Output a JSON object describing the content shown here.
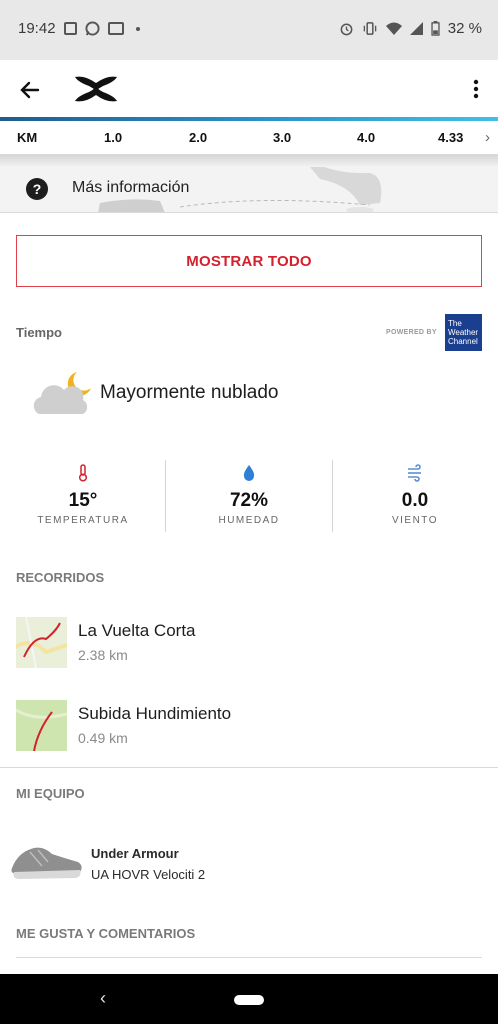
{
  "status_bar": {
    "time": "19:42",
    "left_icons": [
      "image-icon",
      "whatsapp-icon",
      "contact-card-icon",
      "dot-icon"
    ],
    "right_icons": [
      "alarm-icon",
      "vibrate-icon",
      "wifi-icon",
      "signal-icon",
      "battery-icon"
    ],
    "battery": "32 %"
  },
  "toolbar": {
    "back_icon": "arrow-left-icon",
    "logo": "under-armour-logo",
    "menu_icon": "more-vert-icon"
  },
  "splits": {
    "unit": "KM",
    "values": [
      "1.0",
      "2.0",
      "3.0",
      "4.0",
      "4.33"
    ]
  },
  "more_info": {
    "label": "Más información"
  },
  "show_all": {
    "label": "MOSTRAR TODO"
  },
  "weather": {
    "title": "Tiempo",
    "powered_by": "POWERED BY",
    "provider": "The Weather Channel",
    "provider_lines": [
      "The",
      "Weather",
      "Channel"
    ],
    "condition": "Mayormente nublado",
    "stats": [
      {
        "icon": "thermometer-icon",
        "value": "15°",
        "label": "TEMPERATURA"
      },
      {
        "icon": "water-drop-icon",
        "value": "72%",
        "label": "HUMEDAD"
      },
      {
        "icon": "wind-icon",
        "value": "0.0",
        "label": "VIENTO"
      }
    ]
  },
  "routes": {
    "title": "RECORRIDOS",
    "items": [
      {
        "name": "La Vuelta Corta",
        "distance": "2.38 km"
      },
      {
        "name": "Subida Hundimiento",
        "distance": "0.49 km"
      }
    ]
  },
  "equipment": {
    "title": "MI EQUIPO",
    "brand": "Under Armour",
    "model": "UA HOVR Velociti 2"
  },
  "likes": {
    "title": "ME GUSTA Y COMENTARIOS"
  },
  "colors": {
    "accent_red": "#d5202d",
    "bar_gradient_start": "#1f5d8f",
    "bar_gradient_end": "#40bfe8"
  }
}
